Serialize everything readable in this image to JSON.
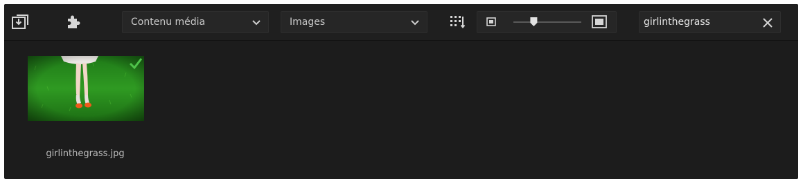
{
  "toolbar": {
    "import_icon": "import-folder-icon",
    "plugin_icon": "puzzle-plugin-icon",
    "content_type": {
      "selected": "Contenu média"
    },
    "media_filter": {
      "selected": "Images"
    },
    "view_icon": "grid-sort-icon",
    "thumbnail_zoom": {
      "small_icon": "small-thumbnail-icon",
      "large_icon": "large-thumbnail-icon",
      "level": 0.3
    },
    "search": {
      "value": "girlinthegrass",
      "clear_icon": "close-icon"
    }
  },
  "library": {
    "items": [
      {
        "filename": "girlinthegrass.jpg",
        "selected_icon": "checkmark-icon"
      }
    ]
  },
  "colors": {
    "background": "#1c1c1c",
    "toolbar": "#1f1f1f",
    "control": "#262626",
    "text": "#c9c9c9",
    "check": "#4fc34a",
    "grass": "#2a8a1e"
  }
}
